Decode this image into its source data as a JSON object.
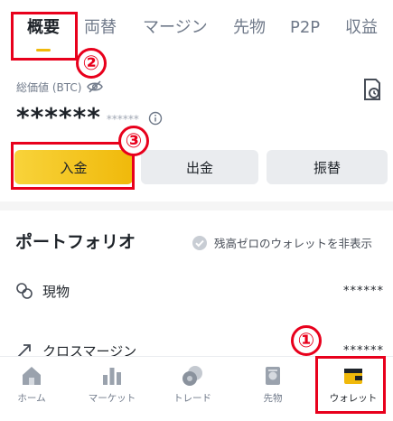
{
  "tabs": [
    {
      "label": "概要",
      "active": true
    },
    {
      "label": "両替"
    },
    {
      "label": "マージン"
    },
    {
      "label": "先物"
    },
    {
      "label": "P2P"
    },
    {
      "label": "収益"
    }
  ],
  "overview": {
    "total_label": "総価値 (BTC)",
    "balance": "******",
    "balance_sub": "******"
  },
  "actions": {
    "deposit": "入金",
    "withdraw": "出金",
    "transfer": "振替"
  },
  "portfolio": {
    "title": "ポートフォリオ",
    "hide_zero_label": "残高ゼロのウォレットを非表示",
    "rows": [
      {
        "label": "現物",
        "value": "******",
        "icon": "spot-icon"
      },
      {
        "label": "クロスマージン",
        "value": "******",
        "icon": "cross-margin-icon"
      }
    ]
  },
  "bottom_nav": [
    {
      "label": "ホーム",
      "icon": "home-icon"
    },
    {
      "label": "マーケット",
      "icon": "markets-icon"
    },
    {
      "label": "トレード",
      "icon": "trade-icon"
    },
    {
      "label": "先物",
      "icon": "futures-icon"
    },
    {
      "label": "ウォレット",
      "icon": "wallet-icon",
      "active": true
    }
  ],
  "annotations": {
    "step1": "①",
    "step2": "②",
    "step3": "③"
  },
  "colors": {
    "accent": "#f0b90b",
    "highlight": "#e8001c",
    "text": "#1e2329",
    "muted": "#707a8a"
  }
}
